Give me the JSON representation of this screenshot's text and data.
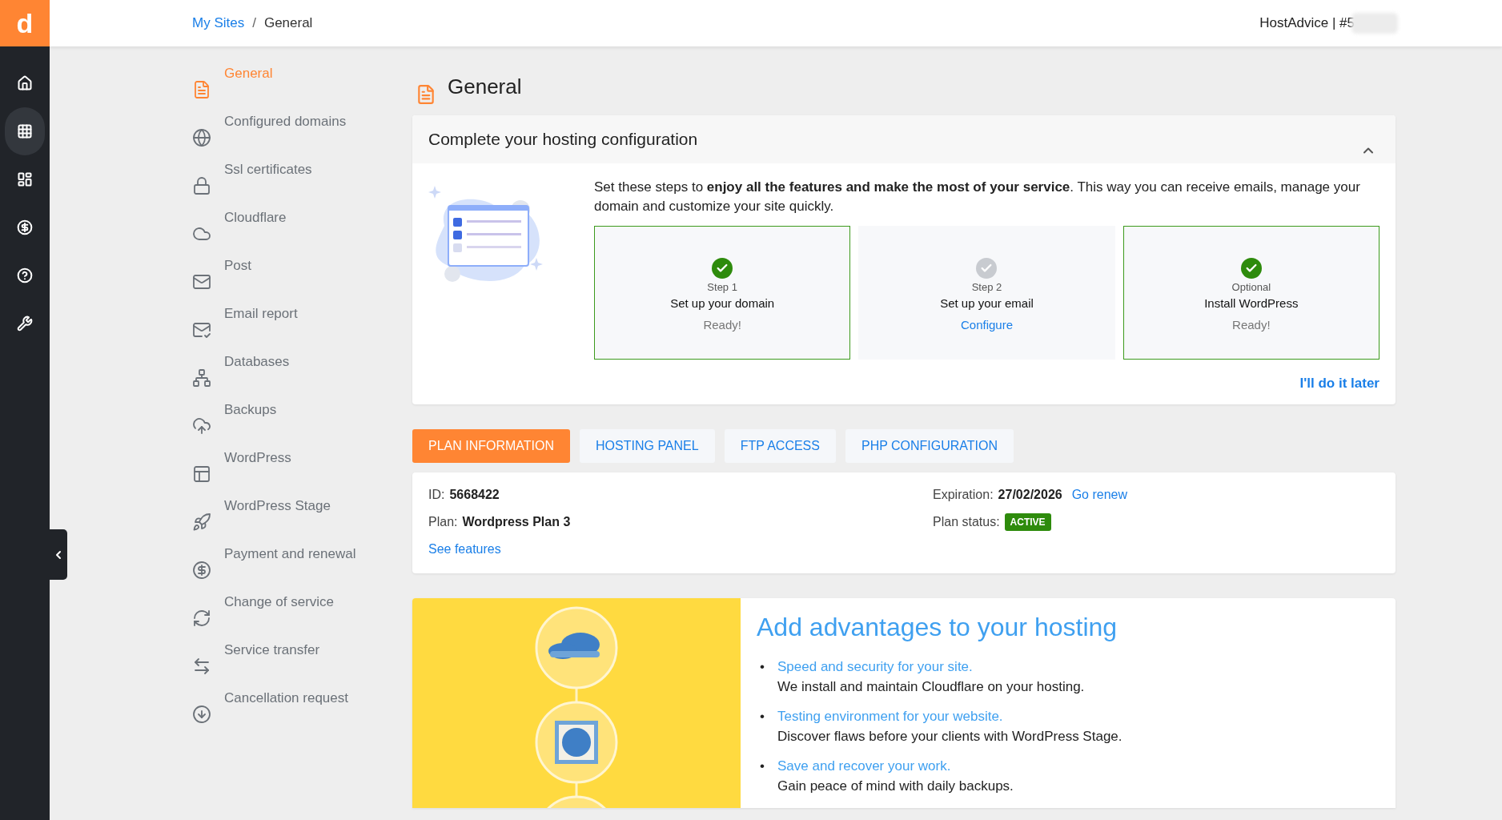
{
  "logo": {
    "letter": "d"
  },
  "rail": {
    "items": [
      {
        "selected": false
      },
      {
        "selected": true
      },
      {
        "selected": false
      },
      {
        "selected": false
      },
      {
        "selected": false
      },
      {
        "selected": false
      }
    ]
  },
  "breadcrumb": {
    "link": "My Sites",
    "separator": "/",
    "current": "General"
  },
  "account": {
    "label": "HostAdvice | #5"
  },
  "submenu": {
    "items": [
      {
        "label": "General",
        "selected": true
      },
      {
        "label": "Configured domains",
        "selected": false
      },
      {
        "label": "Ssl certificates",
        "selected": false
      },
      {
        "label": "Cloudflare",
        "selected": false
      },
      {
        "label": "Post",
        "selected": false
      },
      {
        "label": "Email report",
        "selected": false
      },
      {
        "label": "Databases",
        "selected": false
      },
      {
        "label": "Backups",
        "selected": false
      },
      {
        "label": "WordPress",
        "selected": false
      },
      {
        "label": "WordPress Stage",
        "selected": false
      },
      {
        "label": "Payment and renewal",
        "selected": false
      },
      {
        "label": "Change of service",
        "selected": false
      },
      {
        "label": "Service transfer",
        "selected": false
      },
      {
        "label": "Cancellation request",
        "selected": false
      }
    ]
  },
  "page": {
    "title": "General"
  },
  "config_card": {
    "title": "Complete your hosting configuration",
    "expanded": true,
    "intro": "Set these steps to **enjoy all the features and make the most of your service**. This way you can receive emails, manage your domain and customize your site quickly.",
    "steps": [
      {
        "caption": "Step 1",
        "title": "Set up your domain",
        "status": "Ready!",
        "done": true
      },
      {
        "caption": "Step 2",
        "title": "Set up your email",
        "status": "Configure",
        "done": false
      },
      {
        "caption": "Optional",
        "title": "Install WordPress",
        "status": "Ready!",
        "done": true
      }
    ],
    "later_link": "I'll do it later"
  },
  "tabs": [
    {
      "label": "PLAN INFORMATION",
      "selected": true
    },
    {
      "label": "HOSTING PANEL",
      "selected": false
    },
    {
      "label": "FTP ACCESS",
      "selected": false
    },
    {
      "label": "PHP CONFIGURATION",
      "selected": false
    }
  ],
  "plan": {
    "id_label": "ID:",
    "id": "5668422",
    "plan_label": "Plan:",
    "plan": "Wordpress Plan 3",
    "features_link": "See features",
    "expiration_label": "Expiration:",
    "expiration": "27/02/2026",
    "renew_link": "Go renew",
    "status_label": "Plan status:",
    "status": "ACTIVE"
  },
  "advantages": {
    "title": "Add advantages to your hosting",
    "bullet": "•",
    "items": [
      {
        "title": "Speed and security for your site.",
        "text": "We install and maintain Cloudflare on your hosting."
      },
      {
        "title": "Testing environment for your website.",
        "text": "Discover flaws before your clients with WordPress Stage."
      },
      {
        "title": "Save and recover your work.",
        "text": "Gain peace of mind with daily backups."
      }
    ]
  }
}
